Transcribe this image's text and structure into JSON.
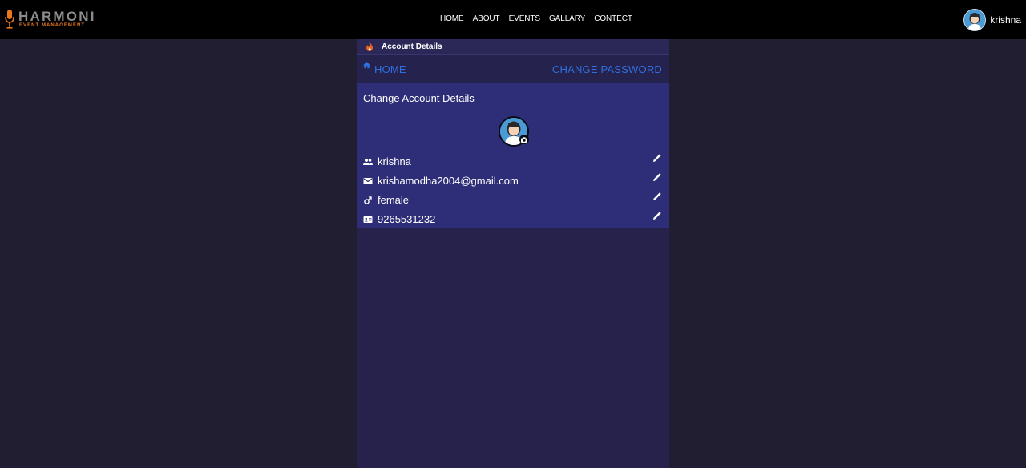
{
  "brand": {
    "name": "HARMONI",
    "tagline": "EVENT MANAGEMENT"
  },
  "nav": [
    "HOME",
    "ABOUT",
    "EVENTS",
    "GALLARY",
    "CONTECT"
  ],
  "user": {
    "name": "krishna"
  },
  "panel": {
    "title": "Account Details",
    "home_link": "HOME",
    "change_password": "CHANGE PASSWORD",
    "heading": "Change Account Details",
    "fields": {
      "username": "krishna",
      "email": "krishamodha2004@gmail.com",
      "gender": "female",
      "phone": "9265531232"
    }
  },
  "colors": {
    "accent": "#2f6fe0",
    "brand_orange": "#e8771e",
    "panel_bg": "#2d2d78",
    "page_bg": "#211e32"
  }
}
